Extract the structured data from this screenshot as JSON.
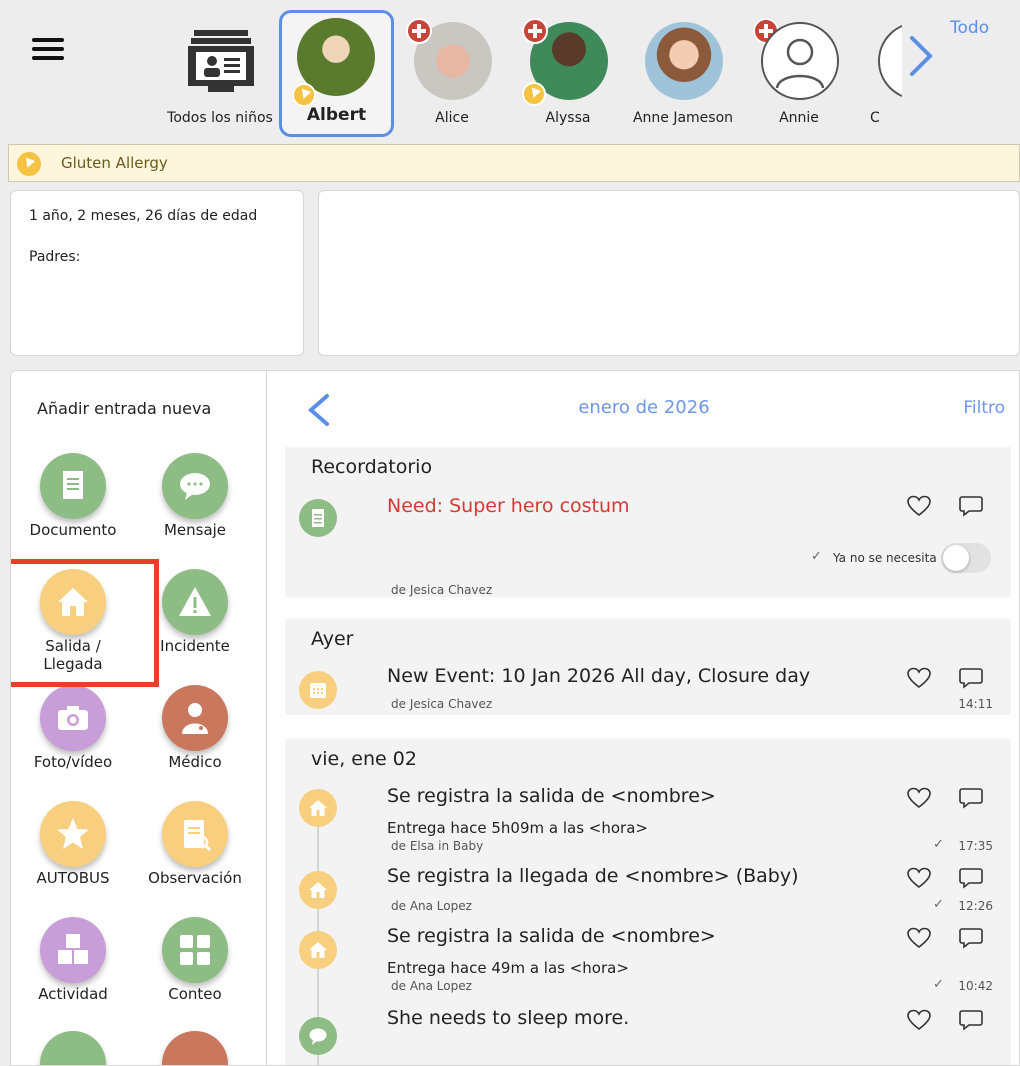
{
  "header": {
    "menu_icon": "hamburger-menu-icon",
    "todo_label": "Todo",
    "children": [
      {
        "name": "Todos los niños",
        "type": "all"
      },
      {
        "name": "Albert",
        "selected": true,
        "allergy": true
      },
      {
        "name": "Alice",
        "medical": true
      },
      {
        "name": "Alyssa",
        "medical": true,
        "allergy": true
      },
      {
        "name": "Anne Jameson",
        "medical": true
      },
      {
        "name": "Annie",
        "type": "placeholder"
      },
      {
        "name": "C",
        "type": "partial"
      }
    ]
  },
  "allergy": {
    "label": "Gluten Allergy"
  },
  "info": {
    "age": "1 año, 2 meses, 26 días de edad",
    "parents_label": "Padres:"
  },
  "actions": {
    "title": "Añadir entrada nueva",
    "items": [
      {
        "label": "Documento",
        "color": "#8dbd84"
      },
      {
        "label": "Mensaje",
        "color": "#8dbd84"
      },
      {
        "label": "Salida / Llegada",
        "line1": "Salida /",
        "line2": "Llegada",
        "color": "#f7cf7e"
      },
      {
        "label": "Incidente",
        "color": "#8dbd84"
      },
      {
        "label": "Foto/vídeo",
        "color": "#c89ed8"
      },
      {
        "label": "Médico",
        "color": "#c9785e"
      },
      {
        "label": "AUTOBUS",
        "color": "#f7cf7e"
      },
      {
        "label": "Observación",
        "color": "#f7cf7e"
      },
      {
        "label": "Actividad",
        "color": "#c89ed8"
      },
      {
        "label": "Conteo",
        "color": "#8dbd84"
      }
    ]
  },
  "feed": {
    "month": "enero de 2026",
    "filter": "Filtro",
    "sections": [
      {
        "header": "Recordatorio",
        "entries": [
          {
            "title": "Need: Super hero costum",
            "by": "de Jesica Chavez",
            "toggle_label": "Ya no se necesita",
            "check": "✓"
          }
        ]
      },
      {
        "header": "Ayer",
        "entries": [
          {
            "title": "New Event: 10 Jan 2026 All day, Closure day",
            "by": "de Jesica Chavez",
            "time": "14:11"
          }
        ]
      },
      {
        "header": "vie, ene 02",
        "entries": [
          {
            "title": "Se registra la salida de <nombre>",
            "sub": "Entrega hace 5h09m a las <hora>",
            "by": "de Elsa in Baby",
            "time": "17:35",
            "check": "✓"
          },
          {
            "title": "Se registra la llegada de <nombre> (Baby)",
            "by": "de Ana Lopez",
            "time": "12:26",
            "check": "✓"
          },
          {
            "title": "Se registra la salida de <nombre>",
            "sub": "Entrega hace 49m a las <hora>",
            "by": "de Ana Lopez",
            "time": "10:42",
            "check": "✓"
          },
          {
            "title": "She  needs to sleep more."
          }
        ]
      }
    ]
  },
  "colors": {
    "accent": "#5b8fe6",
    "reminder_red": "#d63a32",
    "green_icon": "#8dbd84",
    "yellow_icon": "#f7cf7e",
    "highlight": "#e64027"
  }
}
